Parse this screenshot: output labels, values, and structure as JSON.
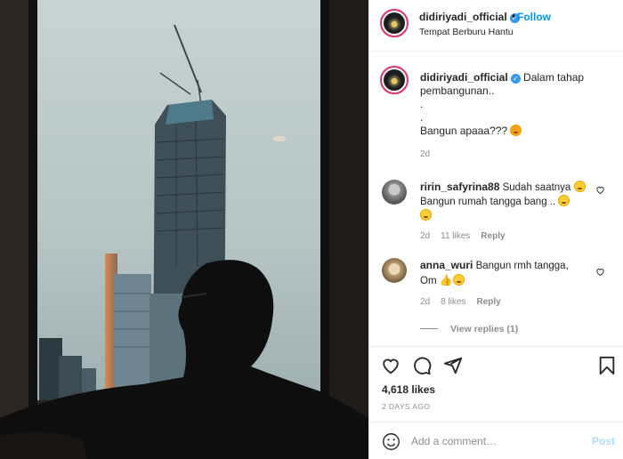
{
  "post": {
    "username": "didiriyadi_official",
    "follow_label": "Follow",
    "location": "Tempat Berburu Hantu"
  },
  "caption": {
    "username": "didiriyadi_official",
    "lines": [
      "Dalam tahap",
      "pembangunan..",
      ".",
      ".",
      "Bangun apaaa???"
    ],
    "time": "2d"
  },
  "comments": [
    {
      "username": "ririn_safyrina88",
      "text_line1": "Sudah saatnya",
      "text_line2": "Bangun rumah tangga bang ..",
      "time": "2d",
      "likes": "11 likes",
      "reply_label": "Reply"
    },
    {
      "username": "anna_wuri",
      "text_line1": "Bangun rmh tangga,",
      "text_line2": "Om",
      "time": "2d",
      "likes": "8 likes",
      "reply_label": "Reply"
    }
  ],
  "view_replies_label": "View replies (1)",
  "likes_count": "4,618 likes",
  "posted_ago": "2 DAYS AGO",
  "add_comment": {
    "placeholder": "Add a comment…",
    "post_label": "Post"
  },
  "icons": {
    "verified": "verified-badge-icon",
    "like": "heart-icon",
    "comment": "comment-bubble-icon",
    "share": "paper-plane-icon",
    "save": "bookmark-icon",
    "emoji": "smiley-icon"
  },
  "colors": {
    "accent": "#0095f6",
    "verified": "#3897f0",
    "post_disabled": "#b3dbff",
    "muted": "#8e8e8e",
    "story_ring": "#e1306c"
  }
}
